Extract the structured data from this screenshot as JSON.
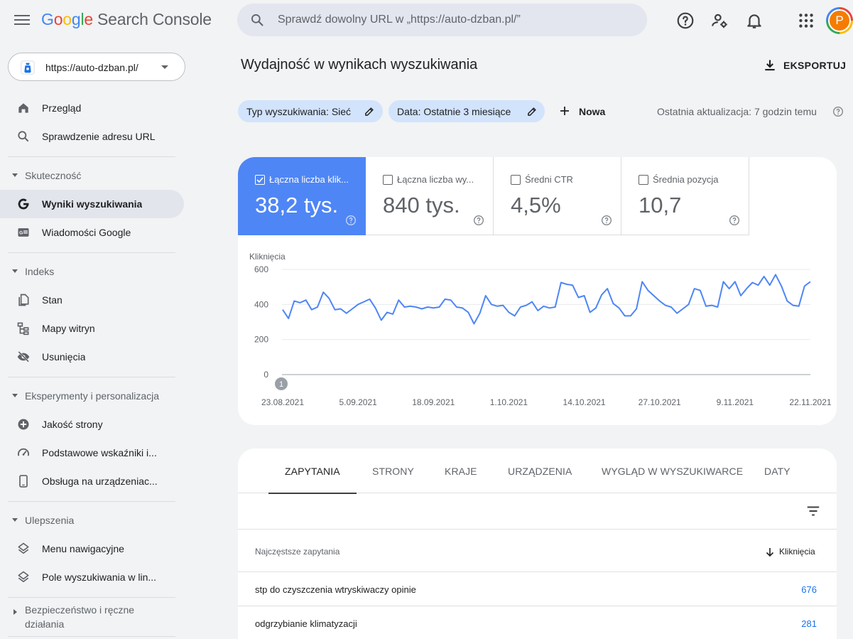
{
  "app": {
    "logo_letters": [
      "G",
      "o",
      "o",
      "g",
      "l",
      "e"
    ],
    "product": "Search Console"
  },
  "search": {
    "placeholder": "Sprawdź dowolny URL w „https://auto-dzban.pl/”"
  },
  "topbar_icons": [
    "help-icon",
    "manage-users-icon",
    "notifications-icon",
    "apps-grid-icon"
  ],
  "account": {
    "initial": "P"
  },
  "property": {
    "label": "https://auto-dzban.pl/"
  },
  "sidebar": {
    "items_top": [
      {
        "label": "Przegląd",
        "icon": "home-icon"
      },
      {
        "label": "Sprawdzenie adresu URL",
        "icon": "search-icon"
      }
    ],
    "sections": [
      {
        "label": "Skuteczność",
        "items": [
          {
            "label": "Wyniki wyszukiwania",
            "icon": "google-g-icon",
            "active": true
          },
          {
            "label": "Wiadomości Google",
            "icon": "news-icon"
          }
        ]
      },
      {
        "label": "Indeks",
        "items": [
          {
            "label": "Stan",
            "icon": "pages-icon"
          },
          {
            "label": "Mapy witryn",
            "icon": "sitemap-icon"
          },
          {
            "label": "Usunięcia",
            "icon": "visibility-off-icon"
          }
        ]
      },
      {
        "label": "Eksperymenty i personalizacja",
        "items": [
          {
            "label": "Jakość strony",
            "icon": "add-circle-icon"
          },
          {
            "label": "Podstawowe wskaźniki i...",
            "icon": "speedometer-icon"
          },
          {
            "label": "Obsługa na urządzeniac...",
            "icon": "smartphone-icon"
          }
        ]
      },
      {
        "label": "Ulepszenia",
        "items": [
          {
            "label": "Menu nawigacyjne",
            "icon": "layers-icon"
          },
          {
            "label": "Pole wyszukiwania w lin...",
            "icon": "layers-icon"
          }
        ]
      },
      {
        "label": "Bezpieczeństwo i ręczne działania",
        "collapsed": true
      }
    ]
  },
  "main": {
    "title": "Wydajność w wynikach wyszukiwania",
    "export_label": "EKSPORTUJ",
    "filters": [
      {
        "label": "Typ wyszukiwania: Sieć"
      },
      {
        "label": "Data: Ostatnie 3 miesiące"
      }
    ],
    "new_label": "Nowa",
    "last_update": "Ostatnia aktualizacja: 7 godzin temu"
  },
  "metrics": [
    {
      "label": "Łączna liczba klik...",
      "value": "38,2 tys.",
      "checked": true,
      "color": "#4e86f5"
    },
    {
      "label": "Łączna liczba wy...",
      "value": "840 tys.",
      "checked": false
    },
    {
      "label": "Średni CTR",
      "value": "4,5%",
      "checked": false
    },
    {
      "label": "Średnia pozycja",
      "value": "10,7",
      "checked": false
    }
  ],
  "chart_data": {
    "type": "line",
    "ylabel": "Kliknięcia",
    "ylim": [
      0,
      600
    ],
    "yticks": [
      0,
      200,
      400,
      600
    ],
    "xticks": [
      "23.08.2021",
      "5.09.2021",
      "18.09.2021",
      "1.10.2021",
      "14.10.2021",
      "27.10.2021",
      "9.11.2021",
      "22.11.2021"
    ],
    "grid": true,
    "annotation": "1",
    "series": [
      {
        "color": "#4e86f5",
        "x_start": "2021-08-23",
        "x_end": "2021-11-22",
        "values": [
          370,
          320,
          420,
          410,
          425,
          370,
          385,
          470,
          435,
          370,
          375,
          350,
          375,
          400,
          415,
          430,
          380,
          310,
          355,
          345,
          425,
          385,
          390,
          385,
          375,
          385,
          380,
          385,
          430,
          425,
          385,
          380,
          355,
          290,
          350,
          450,
          400,
          390,
          395,
          355,
          335,
          385,
          395,
          415,
          365,
          390,
          380,
          385,
          525,
          515,
          510,
          440,
          450,
          355,
          380,
          455,
          490,
          405,
          380,
          335,
          335,
          375,
          530,
          480,
          450,
          420,
          395,
          385,
          350,
          375,
          400,
          490,
          480,
          390,
          395,
          385,
          530,
          490,
          530,
          450,
          490,
          525,
          510,
          560,
          510,
          570,
          505,
          420,
          395,
          390,
          505,
          530
        ]
      }
    ]
  },
  "table": {
    "tabs": [
      "ZAPYTANIA",
      "STRONY",
      "KRAJE",
      "URZĄDZENIA",
      "WYGLĄD W WYSZUKIWARCE",
      "DATY"
    ],
    "active_tab": 0,
    "col_query": "Najczęstsze zapytania",
    "col_clicks": "Kliknięcia",
    "rows": [
      {
        "query": "stp do czyszczenia wtryskiwaczy opinie",
        "clicks": "676"
      },
      {
        "query": "odgrzybianie klimatyzacji",
        "clicks": "281"
      }
    ]
  }
}
